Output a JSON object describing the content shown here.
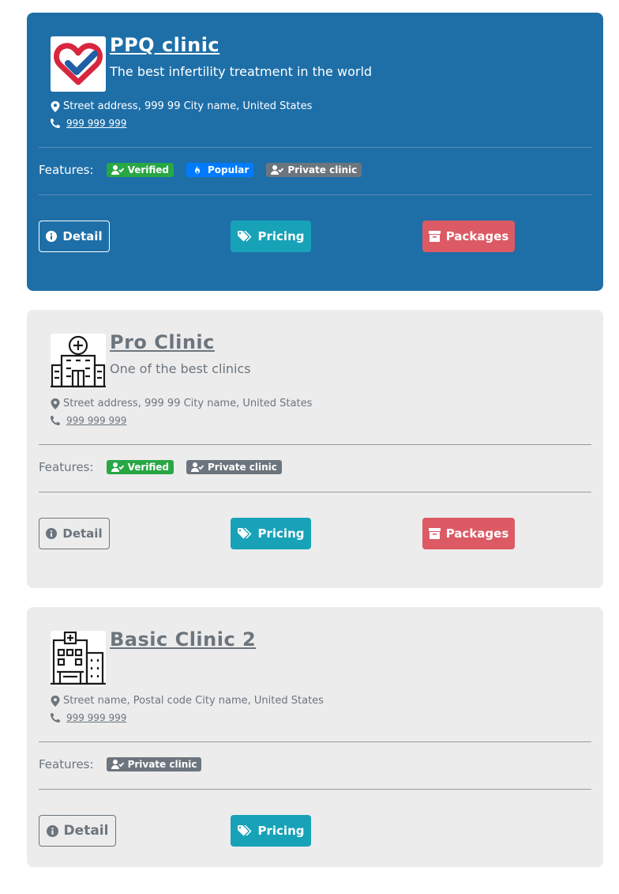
{
  "cards": [
    {
      "name": "PPQ clinic",
      "tagline": "The best infertility treatment in the world",
      "address": "Street address, 999 99 City name, United States",
      "phone": "999 999 999",
      "features_label": "Features:",
      "badges": [
        "Verified",
        "Popular",
        "Private clinic"
      ],
      "detail_label": "Detail",
      "pricing_label": "Pricing",
      "packages_label": "Packages"
    },
    {
      "name": "Pro Clinic",
      "tagline": "One of the best clinics",
      "address": "Street address, 999 99 City name, United States",
      "phone": "999 999 999",
      "features_label": "Features:",
      "badges": [
        "Verified",
        "Private clinic"
      ],
      "detail_label": "Detail",
      "pricing_label": "Pricing",
      "packages_label": "Packages"
    },
    {
      "name": "Basic Clinic 2",
      "tagline": "",
      "address": "Street name, Postal code City name, United States",
      "phone": "999 999 999",
      "features_label": "Features:",
      "badges": [
        "Private clinic"
      ],
      "detail_label": "Detail",
      "pricing_label": "Pricing"
    }
  ],
  "colors": {
    "featured_bg": "#1e6fa8",
    "basic_bg": "#ececec",
    "verified": "#28a745",
    "popular": "#007bff",
    "private": "#6c757d",
    "pricing": "#17a2b8",
    "packages": "#dc5a64"
  },
  "icons": [
    "heart-check-logo",
    "hospital-logo",
    "hospital-building-logo",
    "map-marker-icon",
    "phone-icon",
    "user-check-icon",
    "fire-icon",
    "info-icon",
    "tags-icon",
    "archive-icon"
  ]
}
